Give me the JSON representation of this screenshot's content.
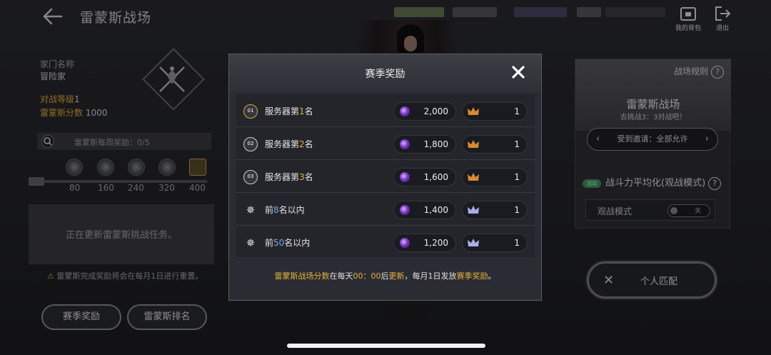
{
  "header": {
    "title": "雷蒙斯战场",
    "bag_label": "我的背包",
    "exit_label": "退出"
  },
  "profile": {
    "family_label": "家门名称",
    "family_value": "冒险家",
    "battle_level_label": "对战等级",
    "battle_level_value": "1",
    "score_label": "雷蒙斯分数",
    "score_value": "1000"
  },
  "weekly": {
    "label": "雷蒙斯每周奖励：0/5",
    "ticks": [
      "80",
      "160",
      "240",
      "320",
      "400"
    ]
  },
  "task": {
    "status_text": "正在更新雷蒙斯挑战任务。"
  },
  "notice": {
    "text": "雷蒙斯完成奖励将会在每月1日进行重置。"
  },
  "left_buttons": {
    "season_reward": "赛季奖励",
    "ranking": "雷蒙斯排名"
  },
  "right_panel": {
    "rules_label": "战场规则",
    "title": "雷蒙斯战场",
    "subtitle": "去挑战3：3对战吧！",
    "invite_label": "受到邀请：全部允许",
    "balance_tag": "活动",
    "balance_label": "战斗力平均化(观战模式)",
    "spectate_label": "观战模式",
    "spectate_toggle": "关",
    "match_label": "个人匹配"
  },
  "modal": {
    "title": "赛季奖励",
    "rows": [
      {
        "icon": "01",
        "prefix": "服务器第",
        "num": "1",
        "suffix": "名",
        "points": "2,000",
        "crowns": "1"
      },
      {
        "icon": "02",
        "prefix": "服务器第",
        "num": "2",
        "suffix": "名",
        "points": "1,800",
        "crowns": "1"
      },
      {
        "icon": "03",
        "prefix": "服务器第",
        "num": "3",
        "suffix": "名",
        "points": "1,600",
        "crowns": "1"
      },
      {
        "icon": "",
        "prefix": "前",
        "num": "8",
        "suffix": "名以内",
        "points": "1,400",
        "crowns": "1"
      },
      {
        "icon": "",
        "prefix": "前",
        "num": "50",
        "suffix": "名以内",
        "points": "1,200",
        "crowns": "1"
      }
    ],
    "footer": {
      "part1": "雷蒙斯战场分数",
      "part2": "在每天",
      "part3": "00：00",
      "part4": "后",
      "part5": "更新",
      "part6": "，每月1日发放",
      "part7": "赛季奖励",
      "part8": "。"
    }
  },
  "colors": {
    "accent_gold": "#e5b33c",
    "rank_blue": "#7aa8e8",
    "panel_bg": "#2b2c33"
  }
}
